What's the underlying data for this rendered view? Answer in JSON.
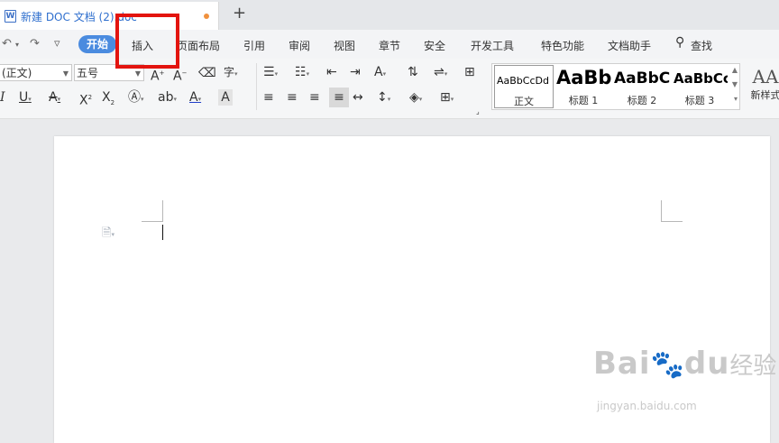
{
  "titlebar": {
    "doc_tab_icon": "W",
    "doc_tab_title": "新建 DOC 文档 (2).doc",
    "modified_dot_color": "#f0913e",
    "new_tab_symbol": "+"
  },
  "menubar": {
    "undo_symbol": "↶",
    "redo_symbol": "↷",
    "more_symbol": "▿",
    "start_label": "开始",
    "items": [
      "插入",
      "页面布局",
      "引用",
      "审阅",
      "视图",
      "章节",
      "安全",
      "开发工具",
      "特色功能",
      "文档助手"
    ],
    "search_label": "查找"
  },
  "ribbon": {
    "font_name": "(正文)",
    "font_size": "五号",
    "styles": [
      {
        "sample": "AaBbCcDd",
        "caption": "正文"
      },
      {
        "sample": "AaBb",
        "caption": "标题 1"
      },
      {
        "sample": "AaBbC",
        "caption": "标题 2"
      },
      {
        "sample": "AaBbCc",
        "caption": "标题 3"
      }
    ],
    "new_style_glyph": "AA",
    "new_style_label": "新样式"
  },
  "annotation": {
    "color": "#e3140f",
    "target": "插入"
  },
  "watermark": {
    "brand": "Bai",
    "brand_suffix": "du",
    "brand_cn": "经验",
    "site": "jingyan.baidu.com"
  }
}
